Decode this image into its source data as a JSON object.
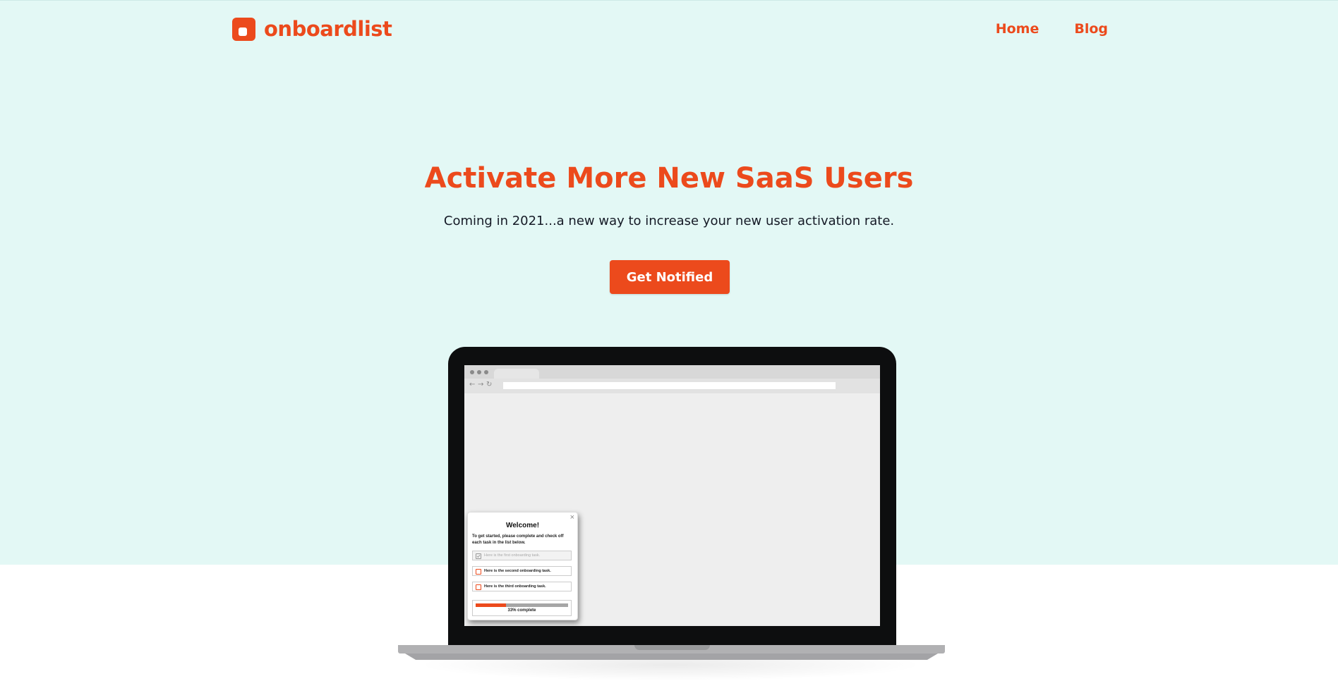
{
  "brand": {
    "name": "onboardlist",
    "logo_icon": "onboardlist-logo-icon",
    "color": "#ec4a1c"
  },
  "nav": {
    "items": [
      {
        "label": "Home"
      },
      {
        "label": "Blog"
      }
    ]
  },
  "hero": {
    "headline": "Activate More New SaaS Users",
    "subhead": "Coming in 2021...a new way to increase your new user activation rate.",
    "cta_label": "Get Notified",
    "background": "#e3f8f5"
  },
  "popup": {
    "title": "Welcome!",
    "close_glyph": "×",
    "description": "To get started, please complete and check off each task in the list below.",
    "tasks": [
      {
        "label": "Here is the first onboarding task.",
        "completed": true
      },
      {
        "label": "Here is the second onboarding task.",
        "completed": false
      },
      {
        "label": "Here is the third onboarding task.",
        "completed": false
      }
    ],
    "progress": {
      "fraction": 0.33,
      "label": "33% complete"
    }
  }
}
